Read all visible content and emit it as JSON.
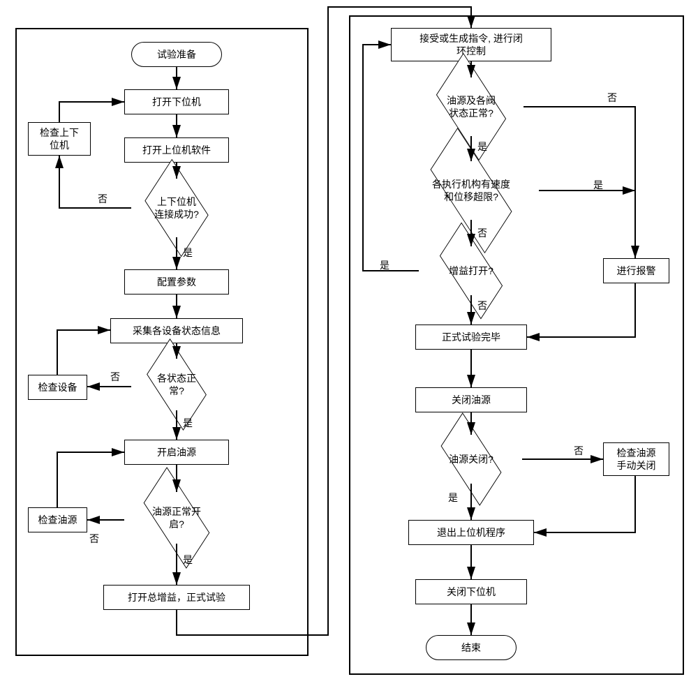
{
  "chart_data": {
    "type": "flowchart",
    "nodes": [
      {
        "id": "start",
        "type": "terminator",
        "text": "试验准备"
      },
      {
        "id": "p1",
        "type": "process",
        "text": "打开下位机"
      },
      {
        "id": "p2",
        "type": "process",
        "text": "打开上位机软件"
      },
      {
        "id": "d1",
        "type": "decision",
        "text": "上下位机\n连接成功?",
        "yes": "是",
        "no": "否"
      },
      {
        "id": "a1",
        "type": "process",
        "text": "检查上下\n位机"
      },
      {
        "id": "p3",
        "type": "process",
        "text": "配置参数"
      },
      {
        "id": "p4",
        "type": "process",
        "text": "采集各设备状态信息"
      },
      {
        "id": "d2",
        "type": "decision",
        "text": "各状态正常?",
        "yes": "是",
        "no": "否"
      },
      {
        "id": "a2",
        "type": "process",
        "text": "检查设备"
      },
      {
        "id": "p5",
        "type": "process",
        "text": "开启油源"
      },
      {
        "id": "d3",
        "type": "decision",
        "text": "油源正常开启?",
        "yes": "是",
        "no": "否"
      },
      {
        "id": "a3",
        "type": "process",
        "text": "检查油源"
      },
      {
        "id": "p6",
        "type": "process",
        "text": "打开总增益，正式试验"
      },
      {
        "id": "p7",
        "type": "process",
        "text": "接受或生成指令, 进行闭\n环控制"
      },
      {
        "id": "d4",
        "type": "decision",
        "text": "油源及各阀\n状态正常?",
        "yes": "是",
        "no": "否"
      },
      {
        "id": "d5",
        "type": "decision",
        "text": "各执行机构有速度\n和位移超限?",
        "yes": "是",
        "no": "否"
      },
      {
        "id": "d6",
        "type": "decision",
        "text": "增益打开?",
        "yes": "是",
        "no": "否"
      },
      {
        "id": "a4",
        "type": "process",
        "text": "进行报警"
      },
      {
        "id": "p8",
        "type": "process",
        "text": "正式试验完毕"
      },
      {
        "id": "p9",
        "type": "process",
        "text": "关闭油源"
      },
      {
        "id": "d7",
        "type": "decision",
        "text": "油源关闭?",
        "yes": "是",
        "no": "否"
      },
      {
        "id": "a5",
        "type": "process",
        "text": "检查油源\n手动关闭"
      },
      {
        "id": "p10",
        "type": "process",
        "text": "退出上位机程序"
      },
      {
        "id": "p11",
        "type": "process",
        "text": "关闭下位机"
      },
      {
        "id": "end",
        "type": "terminator",
        "text": "结束"
      }
    ],
    "edges": [
      {
        "from": "start",
        "to": "p1"
      },
      {
        "from": "p1",
        "to": "p2"
      },
      {
        "from": "p2",
        "to": "d1"
      },
      {
        "from": "d1",
        "to": "p3",
        "label": "是"
      },
      {
        "from": "d1",
        "to": "a1",
        "label": "否"
      },
      {
        "from": "a1",
        "to": "p1"
      },
      {
        "from": "p3",
        "to": "p4"
      },
      {
        "from": "p4",
        "to": "d2"
      },
      {
        "from": "d2",
        "to": "p5",
        "label": "是"
      },
      {
        "from": "d2",
        "to": "a2",
        "label": "否"
      },
      {
        "from": "a2",
        "to": "p4"
      },
      {
        "from": "p5",
        "to": "d3"
      },
      {
        "from": "d3",
        "to": "p6",
        "label": "是"
      },
      {
        "from": "d3",
        "to": "a3",
        "label": "否"
      },
      {
        "from": "a3",
        "to": "p5"
      },
      {
        "from": "p6",
        "to": "p7"
      },
      {
        "from": "p7",
        "to": "d4"
      },
      {
        "from": "d4",
        "to": "d5",
        "label": "是"
      },
      {
        "from": "d4",
        "to": "a4",
        "label": "否"
      },
      {
        "from": "d5",
        "to": "d6",
        "label": "否"
      },
      {
        "from": "d5",
        "to": "a4",
        "label": "是"
      },
      {
        "from": "d6",
        "to": "p7",
        "label": "是"
      },
      {
        "from": "d6",
        "to": "p8",
        "label": "否"
      },
      {
        "from": "a4",
        "to": "p8"
      },
      {
        "from": "p8",
        "to": "p9"
      },
      {
        "from": "p9",
        "to": "d7"
      },
      {
        "from": "d7",
        "to": "p10",
        "label": "是"
      },
      {
        "from": "d7",
        "to": "a5",
        "label": "否"
      },
      {
        "from": "a5",
        "to": "p10"
      },
      {
        "from": "p10",
        "to": "p11"
      },
      {
        "from": "p11",
        "to": "end"
      }
    ]
  },
  "labels": {
    "yes": "是",
    "no": "否"
  },
  "nodes_text": {
    "start": "试验准备",
    "p1": "打开下位机",
    "p2": "打开上位机软件",
    "d1": "上下位机\n连接成功?",
    "a1": "检查上下\n位机",
    "p3": "配置参数",
    "p4": "采集各设备状态信息",
    "d2": "各状态正常?",
    "a2": "检查设备",
    "p5": "开启油源",
    "d3": "油源正常开启?",
    "a3": "检查油源",
    "p6": "打开总增益，正式试验",
    "p7": "接受或生成指令, 进行闭\n环控制",
    "d4": "油源及各阀\n状态正常?",
    "d5": "各执行机构有速度\n和位移超限?",
    "d6": "增益打开?",
    "a4": "进行报警",
    "p8": "正式试验完毕",
    "p9": "关闭油源",
    "d7": "油源关闭?",
    "a5": "检查油源\n手动关闭",
    "p10": "退出上位机程序",
    "p11": "关闭下位机",
    "end": "结束"
  }
}
